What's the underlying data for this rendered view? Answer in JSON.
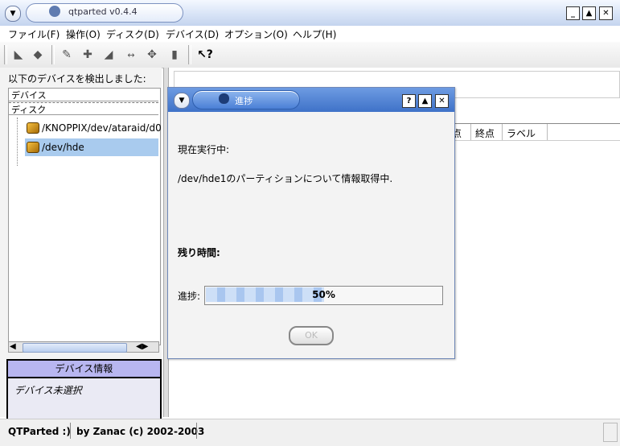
{
  "window": {
    "title": "qtparted v0.4.4"
  },
  "menu": [
    "ファイル(F)",
    "操作(O)",
    "ディスク(D)",
    "デバイス(D)",
    "オプション(O)",
    "ヘルプ(H)"
  ],
  "left": {
    "detected_label": "以下のデバイスを検出しました:",
    "header_device": "デバイス",
    "header_disk": "ディスク",
    "devices": [
      "/KNOPPIX/dev/ataraid/d0",
      "/dev/hde"
    ],
    "info_title": "デバイス情報",
    "info_value": "デバイス未選択"
  },
  "table": {
    "columns": [
      "点",
      "終点",
      "ラベル"
    ]
  },
  "status": {
    "left": "QTParted :)",
    "right": "by Zanac (c) 2002-2003"
  },
  "dialog": {
    "title": "進捗",
    "current_label": "現在実行中:",
    "current_task": "/dev/hde1のパーティションについて情報取得中.",
    "remaining_label": "残り時間:",
    "progress_label": "進捗:",
    "progress_text": "50%",
    "progress_fraction": 0.5,
    "ok_button": "OK"
  },
  "colors": {
    "accent": "#4a7fd6",
    "info_header": "#b8b6f0",
    "progress_fill": "#a9c6ef"
  }
}
